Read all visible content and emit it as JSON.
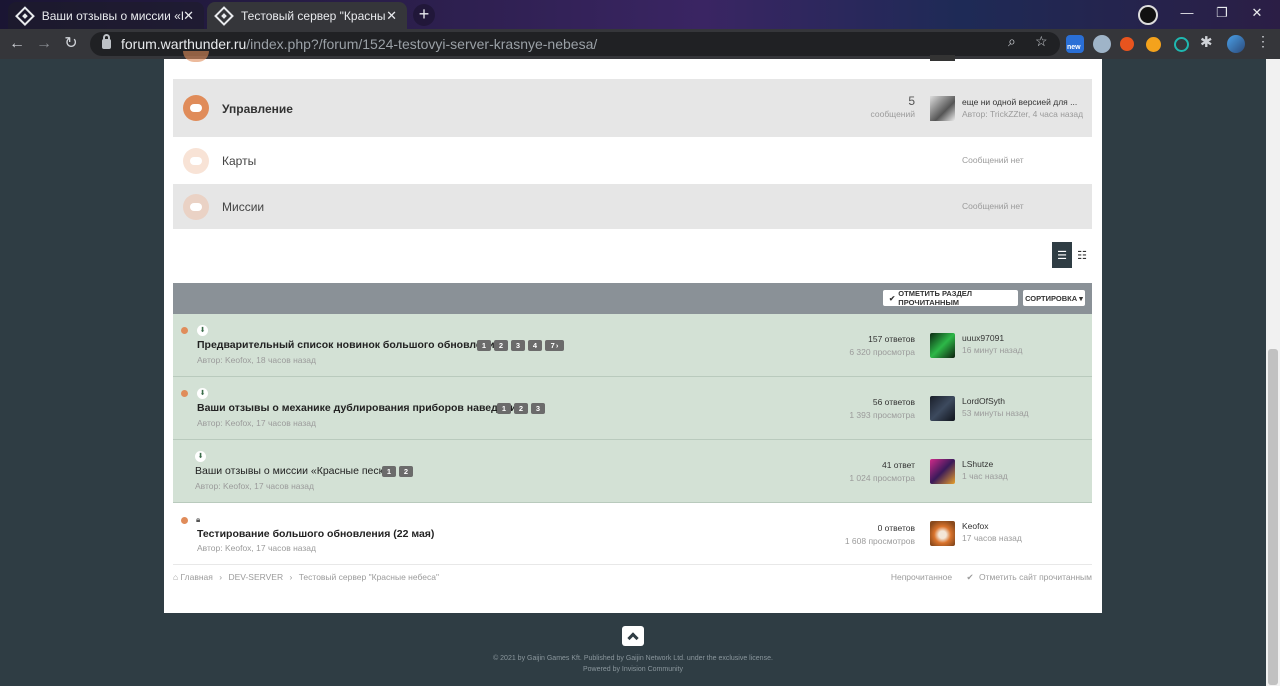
{
  "browser": {
    "tabs": [
      {
        "title": "Ваши отзывы о миссии «Красные пески»",
        "close": "✕"
      },
      {
        "title": "Тестовый сервер \"Красные небеса\"",
        "close": "✕"
      }
    ],
    "new_tab": "+",
    "url_host": "forum.warthunder.ru",
    "url_path": "/index.php?/forum/1524-testovyi-server-krasnye-nebesa/",
    "ext_badge": "new"
  },
  "forums": [
    {
      "title": "Управление",
      "count": "5",
      "count_label": "сообщений",
      "last_title": "еще ни одной версией для ...",
      "last_meta": "Автор: TrickZZter, 4 часа назад"
    },
    {
      "title": "Карты",
      "empty": "Сообщений нет"
    },
    {
      "title": "Миссии",
      "empty": "Сообщений нет"
    }
  ],
  "topic_header": {
    "mark_read": "Отметить раздел прочитанным",
    "sort": "Сортировка"
  },
  "topics": [
    {
      "title": "Предварительный список новинок большого обновления",
      "author": "Автор: Keofox, 18 часов назад",
      "pages": [
        "1",
        "2",
        "3",
        "4",
        "7"
      ],
      "replies": "157 ответов",
      "views": "6 320 просмотра",
      "last_user": "uuux97091",
      "last_time": "16 минут назад"
    },
    {
      "title": "Ваши отзывы о механике дублирования приборов наведения",
      "author": "Автор: Keofox, 17 часов назад",
      "pages": [
        "1",
        "2",
        "3"
      ],
      "replies": "56 ответов",
      "views": "1 393 просмотра",
      "last_user": "LordOfSyth",
      "last_time": "53 минуты назад"
    },
    {
      "title": "Ваши отзывы о миссии «Красные пески»",
      "author": "Автор: Keofox, 17 часов назад",
      "pages": [
        "1",
        "2"
      ],
      "replies": "41 ответ",
      "views": "1 024 просмотра",
      "last_user": "LShutze",
      "last_time": "1 час назад"
    },
    {
      "title": "Тестирование большого обновления (22 мая)",
      "author": "Автор: Keofox, 17 часов назад",
      "pages": [],
      "replies": "0 ответов",
      "views": "1 608 просмотров",
      "last_user": "Keofox",
      "last_time": "17 часов назад"
    }
  ],
  "breadcrumb": {
    "home": "Главная",
    "sep1": "›",
    "dev": "DEV-SERVER",
    "sep2": "›",
    "current": "Тестовый сервер \"Красные небеса\""
  },
  "crumb_actions": {
    "unread": "Непрочитанное",
    "mark_site": "Отметить сайт прочитанным"
  },
  "footer": {
    "copyright": "© 2021 by Gaijin Games Kft. Published by Gaijin Network Ltd. under the exclusive license.",
    "powered": "Powered by Invision Community"
  },
  "colors": {
    "page_bg": "#2f3d44",
    "featured_row": "#d3e1d5",
    "header_bar": "#8a9197",
    "accent_orange": "#e08c5a"
  }
}
